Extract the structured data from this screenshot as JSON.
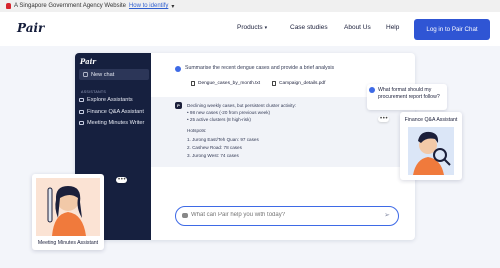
{
  "gov_bar": {
    "text": "A Singapore Government Agency Website",
    "link": "How to identify",
    "caret": "▾"
  },
  "nav": {
    "logo": "Pair",
    "items": [
      {
        "label": "Products",
        "caret": "▾"
      },
      {
        "label": "Case studies"
      },
      {
        "label": "About Us"
      },
      {
        "label": "Help"
      }
    ],
    "login": "Log in to Pair Chat"
  },
  "app": {
    "sidebar": {
      "logo": "Pair",
      "new_chat": "New chat",
      "section": "ASSISTANTS",
      "items": [
        "Explore Assistants",
        "Finance Q&A Assistant",
        "Meeting Minutes Writer"
      ]
    },
    "user_message": "Summarise the recent dengue cases and provide a brief analysis",
    "files": [
      "Dengue_cases_by_month.txt",
      "Campaign_details.pdf"
    ],
    "response": {
      "intro": "Declining weekly cases, but persistent cluster activity:",
      "bullets": [
        "• 98 new cases (-20 from previous week)",
        "• 25 active clusters (8 high-risk)"
      ],
      "hotspots_title": "Hotspots:",
      "hotspots": [
        "1. Jurong East/Teh Quan: 97 cases",
        "2. Cashew Road: 78 cases",
        "3. Jurong West: 74 cases"
      ]
    },
    "input_placeholder": "What can Pair help you with today?",
    "send_icon": "➢"
  },
  "bubble": {
    "lines": [
      "What format should my",
      "procurement report follow?"
    ]
  },
  "cards": {
    "finance": "Finance Q&A Assistant",
    "meeting": "Meeting Minutes Assistant"
  },
  "typing": "• • •",
  "colors": {
    "accent": "#2f55d4",
    "sidebar": "#16203f",
    "illustration": "#f07a3c"
  }
}
